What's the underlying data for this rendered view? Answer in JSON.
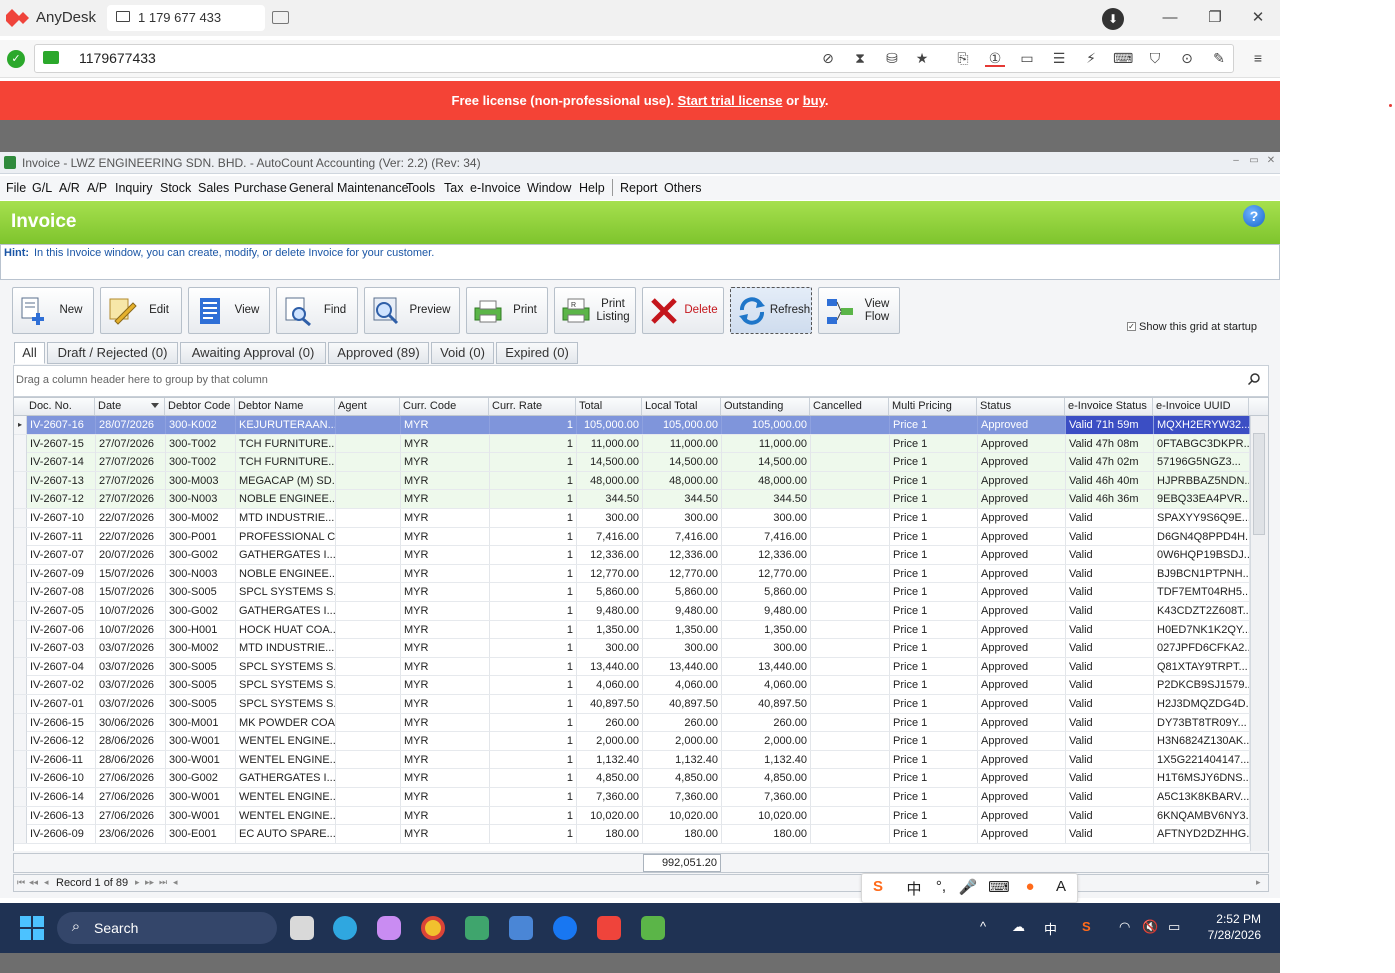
{
  "anydesk": {
    "app_name": "AnyDesk",
    "tab_label": "1 179 677 433",
    "address": "1179677433",
    "license_prefix": "Free license (non-professional use).",
    "license_trial": "Start trial license",
    "license_or": "or",
    "license_buy": "buy",
    "license_end": "."
  },
  "autocount": {
    "window_title": "Invoice - LWZ ENGINEERING SDN. BHD. - AutoCount Accounting (Ver: 2.2) (Rev: 34)",
    "menu": [
      "File",
      "G/L",
      "A/R",
      "A/P",
      "Inquiry",
      "Stock",
      "Sales",
      "Purchase",
      "General Maintenance",
      "Tools",
      "Tax",
      "e-Invoice",
      "Window",
      "Help",
      "Report",
      "Others"
    ],
    "header_title": "Invoice",
    "hint_label": "Hint:",
    "hint_text": "In this Invoice window, you can create, modify, or delete Invoice for your customer.",
    "toolbar": {
      "new": "New",
      "edit": "Edit",
      "view": "View",
      "find": "Find",
      "preview": "Preview",
      "print": "Print",
      "print_listing": "Print Listing",
      "delete": "Delete",
      "refresh": "Refresh",
      "view_flow": "View Flow"
    },
    "startup_label": "Show this grid at startup",
    "filter_tabs": [
      "All",
      "Draft / Rejected (0)",
      "Awaiting Approval (0)",
      "Approved (89)",
      "Void (0)",
      "Expired (0)"
    ],
    "group_hint": "Drag a column header here to group by that column",
    "columns": [
      "Doc. No.",
      "Date",
      "Debtor Code",
      "Debtor Name",
      "Agent",
      "Curr. Code",
      "Curr. Rate",
      "Total",
      "Local Total",
      "Outstanding",
      "Cancelled",
      "Multi Pricing",
      "Status",
      "e-Invoice Status",
      "e-Invoice UUID"
    ],
    "rows": [
      [
        "IV-2607-16",
        "28/07/2026",
        "300-K002",
        "KEJURUTERAAN...",
        "",
        "MYR",
        "1",
        "105,000.00",
        "105,000.00",
        "105,000.00",
        "",
        "Price 1",
        "Approved",
        "Valid 71h 59m",
        "MQXH2ERYW32..."
      ],
      [
        "IV-2607-15",
        "27/07/2026",
        "300-T002",
        "TCH FURNITURE...",
        "",
        "MYR",
        "1",
        "11,000.00",
        "11,000.00",
        "11,000.00",
        "",
        "Price 1",
        "Approved",
        "Valid 47h 08m",
        "0FTABGC3DKPR..."
      ],
      [
        "IV-2607-14",
        "27/07/2026",
        "300-T002",
        "TCH FURNITURE...",
        "",
        "MYR",
        "1",
        "14,500.00",
        "14,500.00",
        "14,500.00",
        "",
        "Price 1",
        "Approved",
        "Valid 47h 02m",
        "57196G5NGZ3..."
      ],
      [
        "IV-2607-13",
        "27/07/2026",
        "300-M003",
        "MEGACAP (M) SD...",
        "",
        "MYR",
        "1",
        "48,000.00",
        "48,000.00",
        "48,000.00",
        "",
        "Price 1",
        "Approved",
        "Valid 46h 40m",
        "HJPRBBAZ5NDN..."
      ],
      [
        "IV-2607-12",
        "27/07/2026",
        "300-N003",
        "NOBLE ENGINEE...",
        "",
        "MYR",
        "1",
        "344.50",
        "344.50",
        "344.50",
        "",
        "Price 1",
        "Approved",
        "Valid 46h 36m",
        "9EBQ33EA4PVR..."
      ],
      [
        "IV-2607-10",
        "22/07/2026",
        "300-M002",
        "MTD INDUSTRIE...",
        "",
        "MYR",
        "1",
        "300.00",
        "300.00",
        "300.00",
        "",
        "Price 1",
        "Approved",
        "Valid",
        "SPAXYY9S6Q9E..."
      ],
      [
        "IV-2607-11",
        "22/07/2026",
        "300-P001",
        "PROFESSIONAL C...",
        "",
        "MYR",
        "1",
        "7,416.00",
        "7,416.00",
        "7,416.00",
        "",
        "Price 1",
        "Approved",
        "Valid",
        "D6GN4Q8PPD4H..."
      ],
      [
        "IV-2607-07",
        "20/07/2026",
        "300-G002",
        "GATHERGATES I...",
        "",
        "MYR",
        "1",
        "12,336.00",
        "12,336.00",
        "12,336.00",
        "",
        "Price 1",
        "Approved",
        "Valid",
        "0W6HQP19BSDJ..."
      ],
      [
        "IV-2607-09",
        "15/07/2026",
        "300-N003",
        "NOBLE ENGINEE...",
        "",
        "MYR",
        "1",
        "12,770.00",
        "12,770.00",
        "12,770.00",
        "",
        "Price 1",
        "Approved",
        "Valid",
        "BJ9BCN1PTPNH..."
      ],
      [
        "IV-2607-08",
        "15/07/2026",
        "300-S005",
        "SPCL SYSTEMS S...",
        "",
        "MYR",
        "1",
        "5,860.00",
        "5,860.00",
        "5,860.00",
        "",
        "Price 1",
        "Approved",
        "Valid",
        "TDF7EMT04RH5..."
      ],
      [
        "IV-2607-05",
        "10/07/2026",
        "300-G002",
        "GATHERGATES I...",
        "",
        "MYR",
        "1",
        "9,480.00",
        "9,480.00",
        "9,480.00",
        "",
        "Price 1",
        "Approved",
        "Valid",
        "K43CDZT2Z608T..."
      ],
      [
        "IV-2607-06",
        "10/07/2026",
        "300-H001",
        "HOCK HUAT COA...",
        "",
        "MYR",
        "1",
        "1,350.00",
        "1,350.00",
        "1,350.00",
        "",
        "Price 1",
        "Approved",
        "Valid",
        "H0ED7NK1K2QY..."
      ],
      [
        "IV-2607-03",
        "03/07/2026",
        "300-M002",
        "MTD INDUSTRIE...",
        "",
        "MYR",
        "1",
        "300.00",
        "300.00",
        "300.00",
        "",
        "Price 1",
        "Approved",
        "Valid",
        "027JPFD6CFKA2..."
      ],
      [
        "IV-2607-04",
        "03/07/2026",
        "300-S005",
        "SPCL SYSTEMS S...",
        "",
        "MYR",
        "1",
        "13,440.00",
        "13,440.00",
        "13,440.00",
        "",
        "Price 1",
        "Approved",
        "Valid",
        "Q81XTAY9TRPT..."
      ],
      [
        "IV-2607-02",
        "03/07/2026",
        "300-S005",
        "SPCL SYSTEMS S...",
        "",
        "MYR",
        "1",
        "4,060.00",
        "4,060.00",
        "4,060.00",
        "",
        "Price 1",
        "Approved",
        "Valid",
        "P2DKCB9SJ1579..."
      ],
      [
        "IV-2607-01",
        "03/07/2026",
        "300-S005",
        "SPCL SYSTEMS S...",
        "",
        "MYR",
        "1",
        "40,897.50",
        "40,897.50",
        "40,897.50",
        "",
        "Price 1",
        "Approved",
        "Valid",
        "H2J3DMQZDG4D..."
      ],
      [
        "IV-2606-15",
        "30/06/2026",
        "300-M001",
        "MK POWDER COA...",
        "",
        "MYR",
        "1",
        "260.00",
        "260.00",
        "260.00",
        "",
        "Price 1",
        "Approved",
        "Valid",
        "DY73BT8TR09Y..."
      ],
      [
        "IV-2606-12",
        "28/06/2026",
        "300-W001",
        "WENTEL ENGINE...",
        "",
        "MYR",
        "1",
        "2,000.00",
        "2,000.00",
        "2,000.00",
        "",
        "Price 1",
        "Approved",
        "Valid",
        "H3N6824Z130AK..."
      ],
      [
        "IV-2606-11",
        "28/06/2026",
        "300-W001",
        "WENTEL ENGINE...",
        "",
        "MYR",
        "1",
        "1,132.40",
        "1,132.40",
        "1,132.40",
        "",
        "Price 1",
        "Approved",
        "Valid",
        "1X5G221404147..."
      ],
      [
        "IV-2606-10",
        "27/06/2026",
        "300-G002",
        "GATHERGATES I...",
        "",
        "MYR",
        "1",
        "4,850.00",
        "4,850.00",
        "4,850.00",
        "",
        "Price 1",
        "Approved",
        "Valid",
        "H1T6MSJY6DNS..."
      ],
      [
        "IV-2606-14",
        "27/06/2026",
        "300-W001",
        "WENTEL ENGINE...",
        "",
        "MYR",
        "1",
        "7,360.00",
        "7,360.00",
        "7,360.00",
        "",
        "Price 1",
        "Approved",
        "Valid",
        "A5C13K8KBARV..."
      ],
      [
        "IV-2606-13",
        "27/06/2026",
        "300-W001",
        "WENTEL ENGINE...",
        "",
        "MYR",
        "1",
        "10,020.00",
        "10,020.00",
        "10,020.00",
        "",
        "Price 1",
        "Approved",
        "Valid",
        "6KNQAMBV6NY3..."
      ],
      [
        "IV-2606-09",
        "23/06/2026",
        "300-E001",
        "EC AUTO SPARE...",
        "",
        "MYR",
        "1",
        "180.00",
        "180.00",
        "180.00",
        "",
        "Price 1",
        "Approved",
        "Valid",
        "AFTNYD2DZHHG..."
      ]
    ],
    "selected_row": 0,
    "highlighted_rows": [
      1,
      2,
      3,
      4
    ],
    "grand_total": "992,051.20",
    "record_nav": "Record 1 of 89"
  },
  "taskbar": {
    "search_label": "Search",
    "time": "2:52 PM",
    "date": "7/28/2026",
    "ime_lang": "中"
  },
  "colors": {
    "license_bar": "#f44336",
    "header_green": "#8ccf38",
    "selected_row": "#7f95db",
    "taskbar": "#1f3253"
  }
}
